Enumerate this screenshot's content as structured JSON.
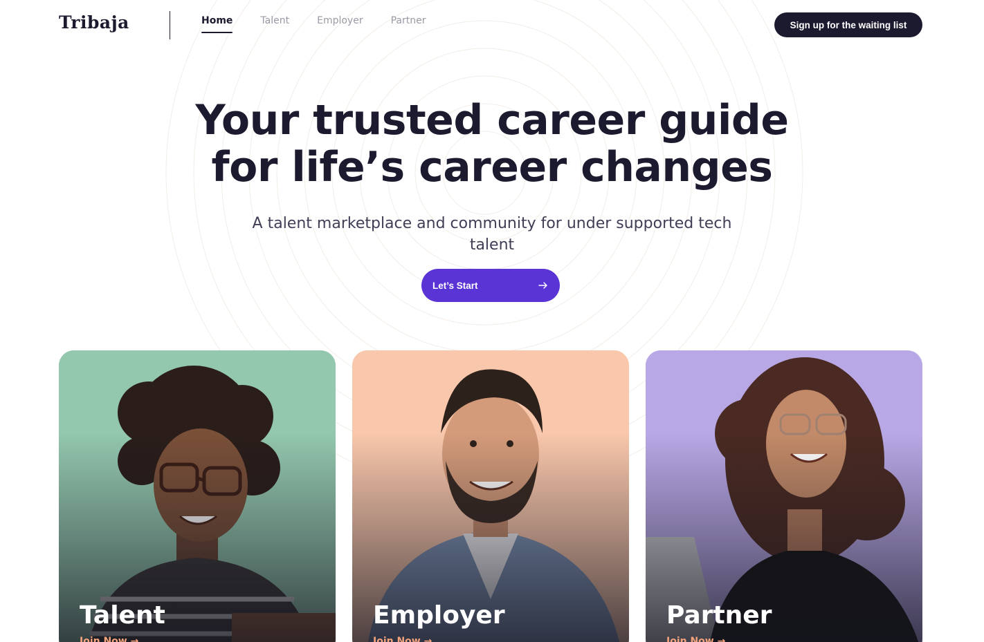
{
  "brand": {
    "logo": "Tribaja"
  },
  "nav": {
    "items": [
      {
        "label": "Home",
        "active": true
      },
      {
        "label": "Talent",
        "active": false
      },
      {
        "label": "Employer",
        "active": false
      },
      {
        "label": "Partner",
        "active": false
      }
    ]
  },
  "header": {
    "cta_label": "Sign up for the waiting list"
  },
  "hero": {
    "title_line1": "Your trusted career guide",
    "title_line2": "for life’s career changes",
    "subtitle": "A talent marketplace and community for under supported tech talent",
    "cta_label": "Let’s Start",
    "cta_icon": "arrow-right-icon"
  },
  "cards": [
    {
      "title": "Talent",
      "link": "Join Now →",
      "bg_color": "#93c7ae",
      "icon": "talent-portrait"
    },
    {
      "title": "Employer",
      "link": "Join Now →",
      "bg_color": "#f9c7ab",
      "icon": "employer-portrait"
    },
    {
      "title": "Partner",
      "link": "Join Now →",
      "bg_color": "#b8a8e6",
      "icon": "partner-portrait"
    }
  ],
  "colors": {
    "primary": "#5b34d6",
    "dark": "#1b1a2e",
    "accent_link": "#f4a37c",
    "nav_muted": "#9a99a6"
  }
}
